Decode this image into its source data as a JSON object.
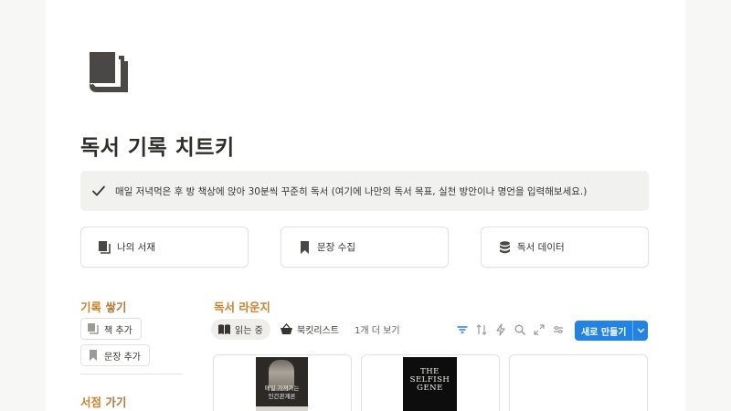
{
  "page": {
    "icon": "book-stack-icon",
    "title": "독서 기록 치트키",
    "callout": {
      "icon": "check-icon",
      "text": "매일 저녁먹은 후 방 책상에 앉아 30분씩 꾸준히 독서 (여기에 나만의 독서 목표, 실천 방안이나 명언을 입력해보세요.)"
    }
  },
  "links": [
    {
      "icon": "book-icon",
      "label": "나의 서재"
    },
    {
      "icon": "bookmark-icon",
      "label": "문장 수집"
    },
    {
      "icon": "database-icon",
      "label": "독서 데이터"
    }
  ],
  "sidebar": {
    "section1": {
      "highlight": "기록",
      "rest": " 쌓기"
    },
    "buttons": [
      {
        "icon": "book-icon",
        "label": "책 추가"
      },
      {
        "icon": "bookmark-icon",
        "label": "문장 추가"
      }
    ],
    "section2": {
      "highlight": "서점",
      "rest": " 가기"
    }
  },
  "lounge": {
    "title": "독서 라운지",
    "tabs": [
      {
        "icon": "open-book-icon",
        "label": "읽는 중",
        "active": true
      },
      {
        "icon": "basket-icon",
        "label": "북킷리스트",
        "active": false
      },
      {
        "label": "1개 더 보기"
      }
    ],
    "toolbar": [
      "filter-icon",
      "sort-icon",
      "lightning-icon",
      "search-icon",
      "expand-icon",
      "settings-sliders-icon"
    ],
    "new_button": "새로 만들기",
    "cards": [
      {
        "cover_text": "매일 가져가는\n인간관계론",
        "cover_color": "#2b2a27"
      },
      {
        "cover_title": "THE\nSELFISH\nGENE",
        "cover_color": "#0d0d0d"
      },
      {
        "empty": true
      }
    ]
  },
  "colors": {
    "accent": "#2383e2",
    "section_label": "#c8842f",
    "callout_bg": "#f1f1ef"
  }
}
